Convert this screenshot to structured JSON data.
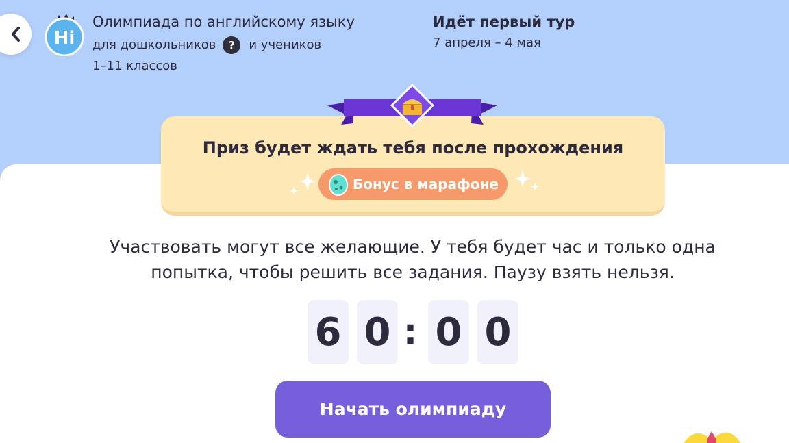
{
  "header": {
    "title_line1": "Олимпиада по английскому языку",
    "title_line2_a": "для дошкольников",
    "help_symbol": "?",
    "title_line2_b": "и учеников",
    "title_line3": "1–11 классов",
    "logo_text": "Hi",
    "round_title": "Идёт первый тур",
    "round_dates": "7 апреля – 4 мая"
  },
  "prize": {
    "text": "Приз будет ждать тебя после прохождения",
    "bonus_label": "Бонус в марафоне"
  },
  "description": "Участвовать могут все желающие. У тебя будет час и только одна попытка, чтобы решить все задания. Паузу взять нельзя.",
  "timer": {
    "minutes_tens": "6",
    "minutes_ones": "0",
    "separator": ":",
    "seconds_tens": "0",
    "seconds_ones": "0"
  },
  "start_button_label": "Начать олимпиаду",
  "colors": {
    "header_bg": "#b3cffb",
    "card_bg": "#fde8b6",
    "pill_bg": "#f69a6c",
    "button_bg": "#775fdc",
    "ribbon": "#6b35d6",
    "logo_bg": "#5cb4ee"
  },
  "icons": [
    "chevron-left-icon",
    "hi-logo-icon",
    "help-icon",
    "treasure-chest-icon",
    "egg-icon",
    "sparkle-icon",
    "gift-icon"
  ]
}
